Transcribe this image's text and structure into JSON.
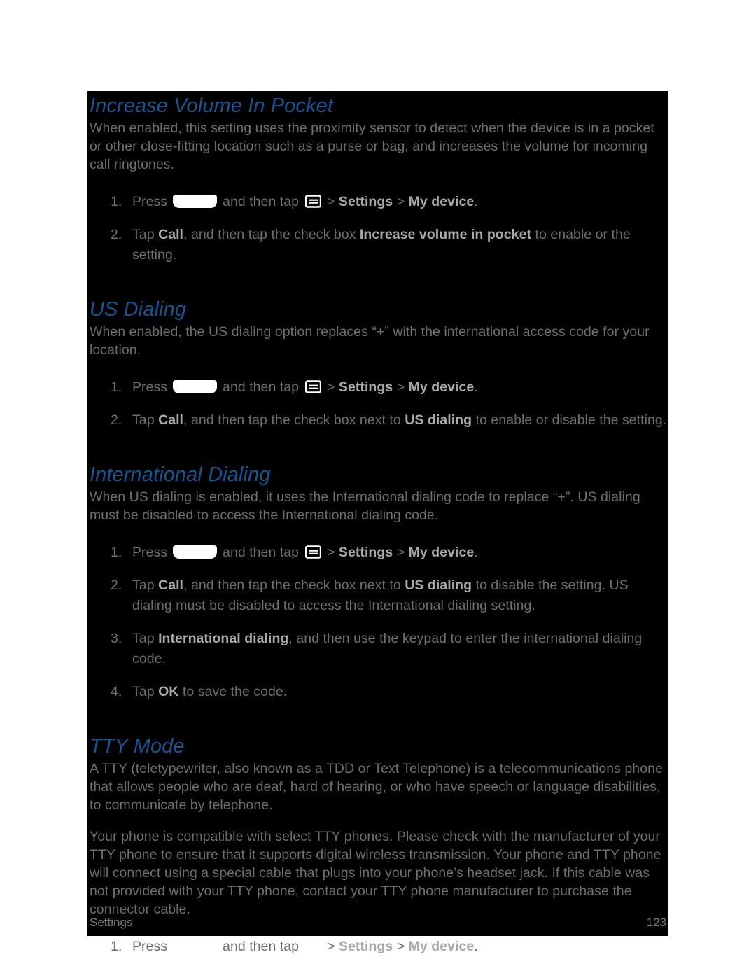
{
  "page": {
    "footer_section": "Settings",
    "footer_page_number": "123",
    "heading_color": "#1a548f",
    "body_color": "#6e6e6e",
    "bold_color": "#a9a9a9",
    "background_color": "#000000",
    "paper_color": "#ffffff"
  },
  "icons": {
    "home_key": "home-key-icon",
    "menu": "menu-icon"
  },
  "sections": [
    {
      "id": "increase-volume-in-pocket",
      "heading": "Increase Volume In Pocket",
      "paragraphs": [
        "When enabled, this setting uses the proximity sensor to detect when the device is in a pocket or other close-fitting location such as a purse or bag, and increases the volume for incoming call ringtones."
      ],
      "steps": [
        {
          "number": "1.",
          "parts": [
            {
              "t": "text",
              "v": "Press "
            },
            {
              "t": "icon",
              "v": "home-key"
            },
            {
              "t": "text",
              "v": " and then tap "
            },
            {
              "t": "icon",
              "v": "menu"
            },
            {
              "t": "text",
              "v": " > "
            },
            {
              "t": "bold",
              "v": "Settings"
            },
            {
              "t": "text",
              "v": " > "
            },
            {
              "t": "bold",
              "v": "My device"
            },
            {
              "t": "text",
              "v": "."
            }
          ]
        },
        {
          "number": "2.",
          "parts": [
            {
              "t": "text",
              "v": "Tap "
            },
            {
              "t": "bold",
              "v": "Call"
            },
            {
              "t": "text",
              "v": ", and then tap the check box "
            },
            {
              "t": "bold",
              "v": "Increase volume in pocket"
            },
            {
              "t": "text",
              "v": " to enable or the setting."
            }
          ]
        }
      ]
    },
    {
      "id": "us-dialing",
      "heading": "US Dialing",
      "paragraphs": [
        "When enabled, the US dialing option replaces “+” with the international access code for your location."
      ],
      "steps": [
        {
          "number": "1.",
          "parts": [
            {
              "t": "text",
              "v": "Press "
            },
            {
              "t": "icon",
              "v": "home-key"
            },
            {
              "t": "text",
              "v": " and then tap "
            },
            {
              "t": "icon",
              "v": "menu"
            },
            {
              "t": "text",
              "v": " > "
            },
            {
              "t": "bold",
              "v": "Settings"
            },
            {
              "t": "text",
              "v": " > "
            },
            {
              "t": "bold",
              "v": "My device"
            },
            {
              "t": "text",
              "v": "."
            }
          ]
        },
        {
          "number": "2.",
          "parts": [
            {
              "t": "text",
              "v": "Tap "
            },
            {
              "t": "bold",
              "v": "Call"
            },
            {
              "t": "text",
              "v": ", and then tap the check box next to "
            },
            {
              "t": "bold",
              "v": "US dialing"
            },
            {
              "t": "text",
              "v": " to enable or disable the setting."
            }
          ]
        }
      ]
    },
    {
      "id": "international-dialing",
      "heading": "International Dialing",
      "paragraphs": [
        "When US dialing is enabled, it uses the International dialing code to replace “+”. US dialing must be disabled to access the International dialing code."
      ],
      "steps": [
        {
          "number": "1.",
          "parts": [
            {
              "t": "text",
              "v": "Press "
            },
            {
              "t": "icon",
              "v": "home-key"
            },
            {
              "t": "text",
              "v": " and then tap "
            },
            {
              "t": "icon",
              "v": "menu"
            },
            {
              "t": "text",
              "v": " > "
            },
            {
              "t": "bold",
              "v": "Settings"
            },
            {
              "t": "text",
              "v": " > "
            },
            {
              "t": "bold",
              "v": "My device"
            },
            {
              "t": "text",
              "v": "."
            }
          ]
        },
        {
          "number": "2.",
          "parts": [
            {
              "t": "text",
              "v": "Tap "
            },
            {
              "t": "bold",
              "v": "Call"
            },
            {
              "t": "text",
              "v": ", and then tap the check box next to "
            },
            {
              "t": "bold",
              "v": "US dialing"
            },
            {
              "t": "text",
              "v": " to disable the setting. US dialing must be disabled to access the International dialing setting."
            }
          ]
        },
        {
          "number": "3.",
          "parts": [
            {
              "t": "text",
              "v": "Tap "
            },
            {
              "t": "bold",
              "v": "International dialing"
            },
            {
              "t": "text",
              "v": ", and then use the keypad to enter the international dialing code."
            }
          ]
        },
        {
          "number": "4.",
          "parts": [
            {
              "t": "text",
              "v": "Tap "
            },
            {
              "t": "bold",
              "v": "OK"
            },
            {
              "t": "text",
              "v": " to save the code."
            }
          ]
        }
      ]
    },
    {
      "id": "tty-mode",
      "heading": "TTY Mode",
      "paragraphs": [
        "A TTY (teletypewriter, also known as a TDD or Text Telephone) is a telecommunications phone that allows people who are deaf, hard of hearing, or who have speech or language disabilities, to communicate by telephone.",
        "Your phone is compatible with select TTY phones. Please check with the manufacturer of your TTY phone to ensure that it supports digital wireless transmission. Your phone and TTY phone will connect using a special cable that plugs into your phone’s headset jack. If this cable was not provided with your TTY phone, contact your TTY phone manufacturer to purchase the connector cable."
      ],
      "steps": [
        {
          "number": "1.",
          "parts": [
            {
              "t": "text",
              "v": "Press "
            },
            {
              "t": "icon",
              "v": "home-key"
            },
            {
              "t": "text",
              "v": " and then tap "
            },
            {
              "t": "icon",
              "v": "menu"
            },
            {
              "t": "text",
              "v": " > "
            },
            {
              "t": "bold",
              "v": "Settings"
            },
            {
              "t": "text",
              "v": " > "
            },
            {
              "t": "bold",
              "v": "My device"
            },
            {
              "t": "text",
              "v": "."
            }
          ]
        }
      ]
    }
  ]
}
